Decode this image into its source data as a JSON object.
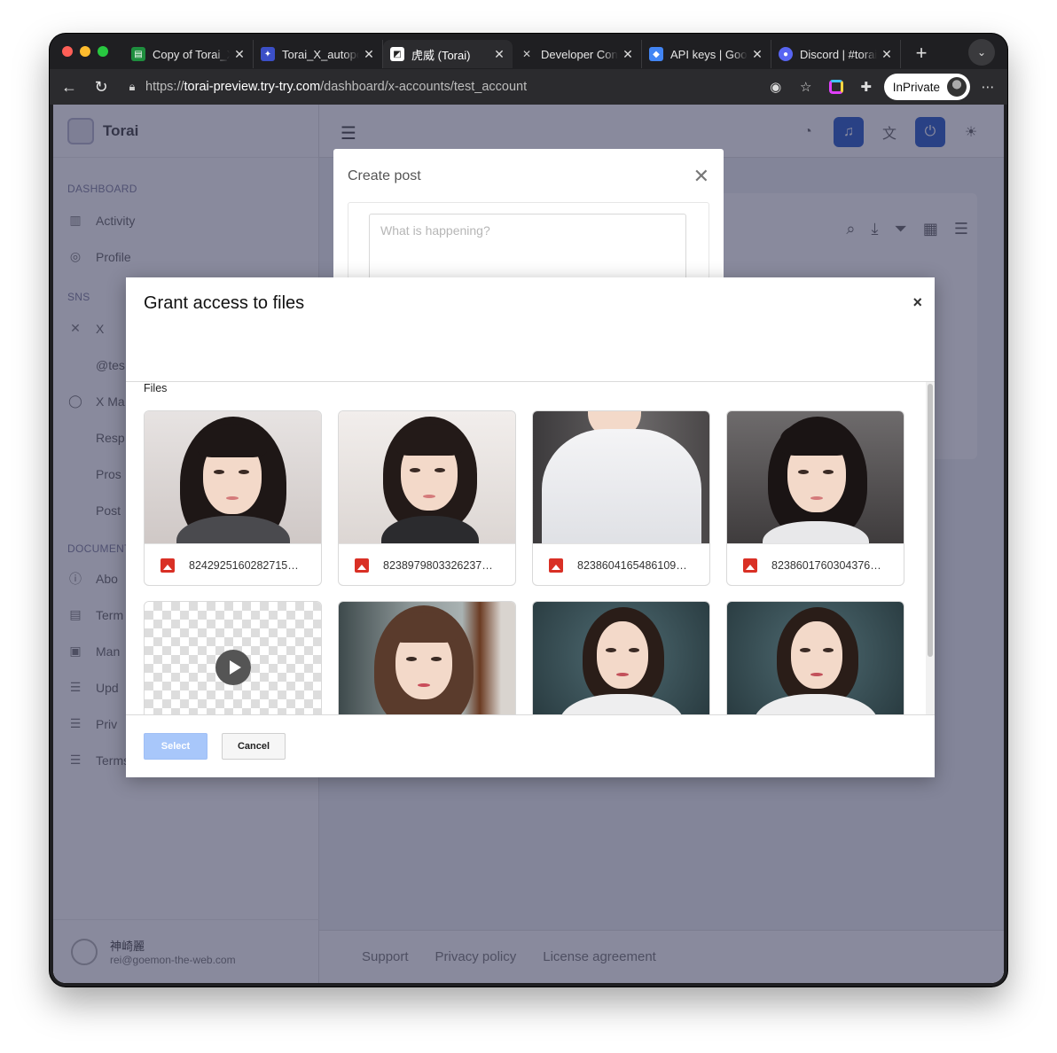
{
  "browser": {
    "tabs": [
      {
        "title": "Copy of Torai_X_",
        "favicon": "sheets-icon",
        "color": "#1e8e3e"
      },
      {
        "title": "Torai_X_autopo",
        "favicon": "app-script-icon",
        "color": "#5b7cf0"
      },
      {
        "title": "虎威 (Torai)",
        "favicon": "torai-icon",
        "color": "#ffffff",
        "active": true
      },
      {
        "title": "Developer Cons",
        "favicon": "x-icon",
        "color": "#000000"
      },
      {
        "title": "API keys | Goog",
        "favicon": "google-cloud-icon",
        "color": "#4285f4"
      },
      {
        "title": "Discord | #torai",
        "favicon": "discord-icon",
        "color": "#5865f2"
      }
    ],
    "url_scheme": "https://",
    "url_host": "torai-preview.try-try.com",
    "url_path": "/dashboard/x-accounts/test_account",
    "profile_label": "InPrivate"
  },
  "app": {
    "brand": "Torai",
    "sections": {
      "dashboard": "DASHBOARD",
      "sns": "SNS",
      "documents": "DOCUMENT"
    },
    "nav_dashboard": [
      "Activity",
      "Profile"
    ],
    "nav_sns": {
      "x": "X",
      "account": "@tes",
      "x_manage": "X Ma",
      "sub": [
        "Resp",
        "Pros",
        "Post"
      ]
    },
    "nav_docs": [
      "Abo",
      "Term",
      "Man",
      "Upd",
      "Priv",
      "Terms and conditions"
    ],
    "user": {
      "name": "神崎麗",
      "email": "rei@goemon-the-web.com"
    },
    "footer_links": [
      "Support",
      "Privacy policy",
      "License agreement"
    ]
  },
  "create_post": {
    "title": "Create post",
    "placeholder": "What is happening?"
  },
  "picker": {
    "title": "Grant access to files",
    "close_label": "×",
    "section_label": "Files",
    "files": [
      {
        "name": "8242925160282715…",
        "type": "image"
      },
      {
        "name": "8238979803326237…",
        "type": "image"
      },
      {
        "name": "8238604165486109…",
        "type": "image"
      },
      {
        "name": "8238601760304376…",
        "type": "image"
      },
      {
        "name": "",
        "type": "video"
      },
      {
        "name": "",
        "type": "image"
      },
      {
        "name": "",
        "type": "image"
      },
      {
        "name": "",
        "type": "image"
      }
    ],
    "select_label": "Select",
    "cancel_label": "Cancel"
  },
  "colors": {
    "accent": "#a8c7fa",
    "overlay": "rgba(20,22,60,.5)"
  }
}
